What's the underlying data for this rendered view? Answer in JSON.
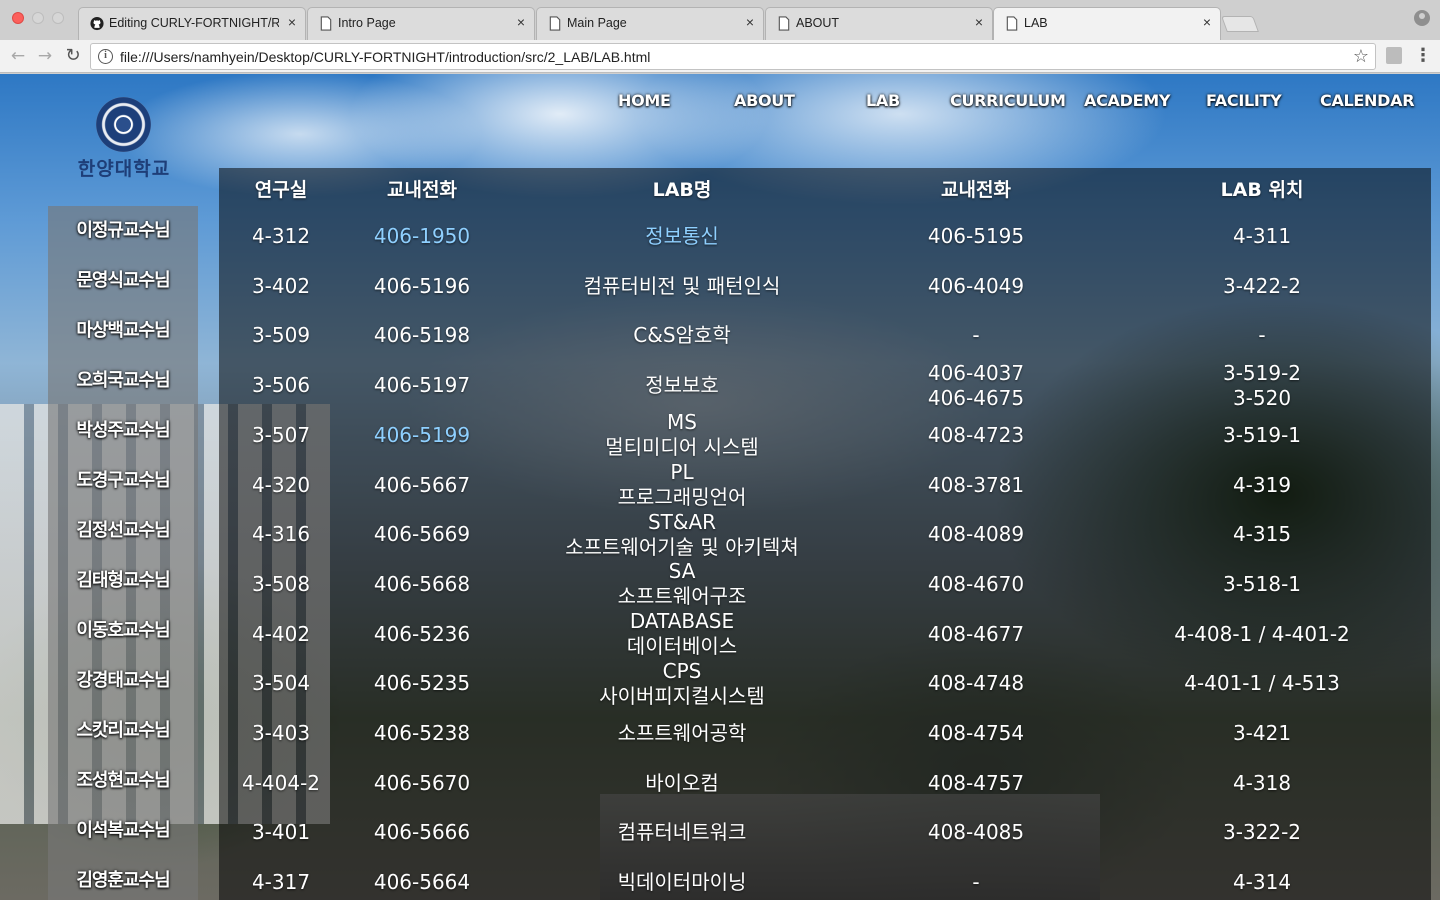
{
  "browser": {
    "tabs": [
      {
        "title": "Editing CURLY-FORTNIGHT/RE",
        "icon": "github-icon",
        "active": false
      },
      {
        "title": "Intro Page",
        "icon": "document-icon",
        "active": false
      },
      {
        "title": "Main Page",
        "icon": "document-icon",
        "active": false
      },
      {
        "title": "ABOUT",
        "icon": "document-icon",
        "active": false
      },
      {
        "title": "LAB",
        "icon": "document-icon",
        "active": true
      }
    ],
    "close_glyph": "×",
    "url": "file:///Users/namhyein/Desktop/CURLY-FORTNIGHT/introduction/src/2_LAB/LAB.html",
    "info_glyph": "i"
  },
  "site": {
    "logo_text": "한양대학교",
    "nav": [
      "HOME",
      "ABOUT",
      "LAB",
      "CURRICULUM",
      "ACADEMY",
      "FACILITY",
      "CALENDAR"
    ]
  },
  "sidebar": {
    "professors": [
      "이정규교수님",
      "문영식교수님",
      "마상백교수님",
      "오희국교수님",
      "박성주교수님",
      "도경구교수님",
      "김정선교수님",
      "김태형교수님",
      "이동호교수님",
      "강경태교수님",
      "스캇리교수님",
      "조성현교수님",
      "이석복교수님",
      "김영훈교수님"
    ]
  },
  "lab_table": {
    "headers": [
      "연구실",
      "교내전화",
      "LAB명",
      "교내전화",
      "LAB 위치"
    ],
    "rows": [
      {
        "room": "4-312",
        "phone": "406-1950",
        "lab": [
          "정보통신"
        ],
        "lab_phone": [
          "406-5195"
        ],
        "location": [
          "4-311"
        ],
        "phone_link": true,
        "lab_link": true
      },
      {
        "room": "3-402",
        "phone": "406-5196",
        "lab": [
          "컴퓨터비전 및 패턴인식"
        ],
        "lab_phone": [
          "406-4049"
        ],
        "location": [
          "3-422-2"
        ],
        "phone_link": false,
        "lab_link": false
      },
      {
        "room": "3-509",
        "phone": "406-5198",
        "lab": [
          "C&S암호학"
        ],
        "lab_phone": [
          "-"
        ],
        "location": [
          "-"
        ],
        "phone_link": false,
        "lab_link": false
      },
      {
        "room": "3-506",
        "phone": "406-5197",
        "lab": [
          "정보보호"
        ],
        "lab_phone": [
          "406-4037",
          "406-4675"
        ],
        "location": [
          "3-519-2",
          "3-520"
        ],
        "phone_link": false,
        "lab_link": false
      },
      {
        "room": "3-507",
        "phone": "406-5199",
        "lab": [
          "MS",
          "멀티미디어 시스템"
        ],
        "lab_phone": [
          "408-4723"
        ],
        "location": [
          "3-519-1"
        ],
        "phone_link": true,
        "lab_link": false
      },
      {
        "room": "4-320",
        "phone": "406-5667",
        "lab": [
          "PL",
          "프로그래밍언어"
        ],
        "lab_phone": [
          "408-3781"
        ],
        "location": [
          "4-319"
        ],
        "phone_link": false,
        "lab_link": false
      },
      {
        "room": "4-316",
        "phone": "406-5669",
        "lab": [
          "ST&AR",
          "소프트웨어기술 및 아키텍쳐"
        ],
        "lab_phone": [
          "408-4089"
        ],
        "location": [
          "4-315"
        ],
        "phone_link": false,
        "lab_link": false
      },
      {
        "room": "3-508",
        "phone": "406-5668",
        "lab": [
          "SA",
          "소프트웨어구조"
        ],
        "lab_phone": [
          "408-4670"
        ],
        "location": [
          "3-518-1"
        ],
        "phone_link": false,
        "lab_link": false
      },
      {
        "room": "4-402",
        "phone": "406-5236",
        "lab": [
          "DATABASE",
          "데이터베이스"
        ],
        "lab_phone": [
          "408-4677"
        ],
        "location": [
          "4-408-1 / 4-401-2"
        ],
        "phone_link": false,
        "lab_link": false
      },
      {
        "room": "3-504",
        "phone": "406-5235",
        "lab": [
          "CPS",
          "사이버피지컬시스템"
        ],
        "lab_phone": [
          "408-4748"
        ],
        "location": [
          "4-401-1 / 4-513"
        ],
        "phone_link": false,
        "lab_link": false
      },
      {
        "room": "3-403",
        "phone": "406-5238",
        "lab": [
          "소프트웨어공학"
        ],
        "lab_phone": [
          "408-4754"
        ],
        "location": [
          "3-421"
        ],
        "phone_link": false,
        "lab_link": false
      },
      {
        "room": "4-404-2",
        "phone": "406-5670",
        "lab": [
          "바이오컴"
        ],
        "lab_phone": [
          "408-4757"
        ],
        "location": [
          "4-318"
        ],
        "phone_link": false,
        "lab_link": false
      },
      {
        "room": "3-401",
        "phone": "406-5666",
        "lab": [
          "컴퓨터네트워크"
        ],
        "lab_phone": [
          "408-4085"
        ],
        "location": [
          "3-322-2"
        ],
        "phone_link": false,
        "lab_link": false
      },
      {
        "room": "4-317",
        "phone": "406-5664",
        "lab": [
          "빅데이터마이닝"
        ],
        "lab_phone": [
          "-"
        ],
        "location": [
          "4-314"
        ],
        "phone_link": false,
        "lab_link": false
      }
    ]
  },
  "colors": {
    "link": "#8fd0ff",
    "panel": "rgba(0,0,0,0.52)",
    "sidebar": "rgba(120,120,120,0.62)"
  }
}
